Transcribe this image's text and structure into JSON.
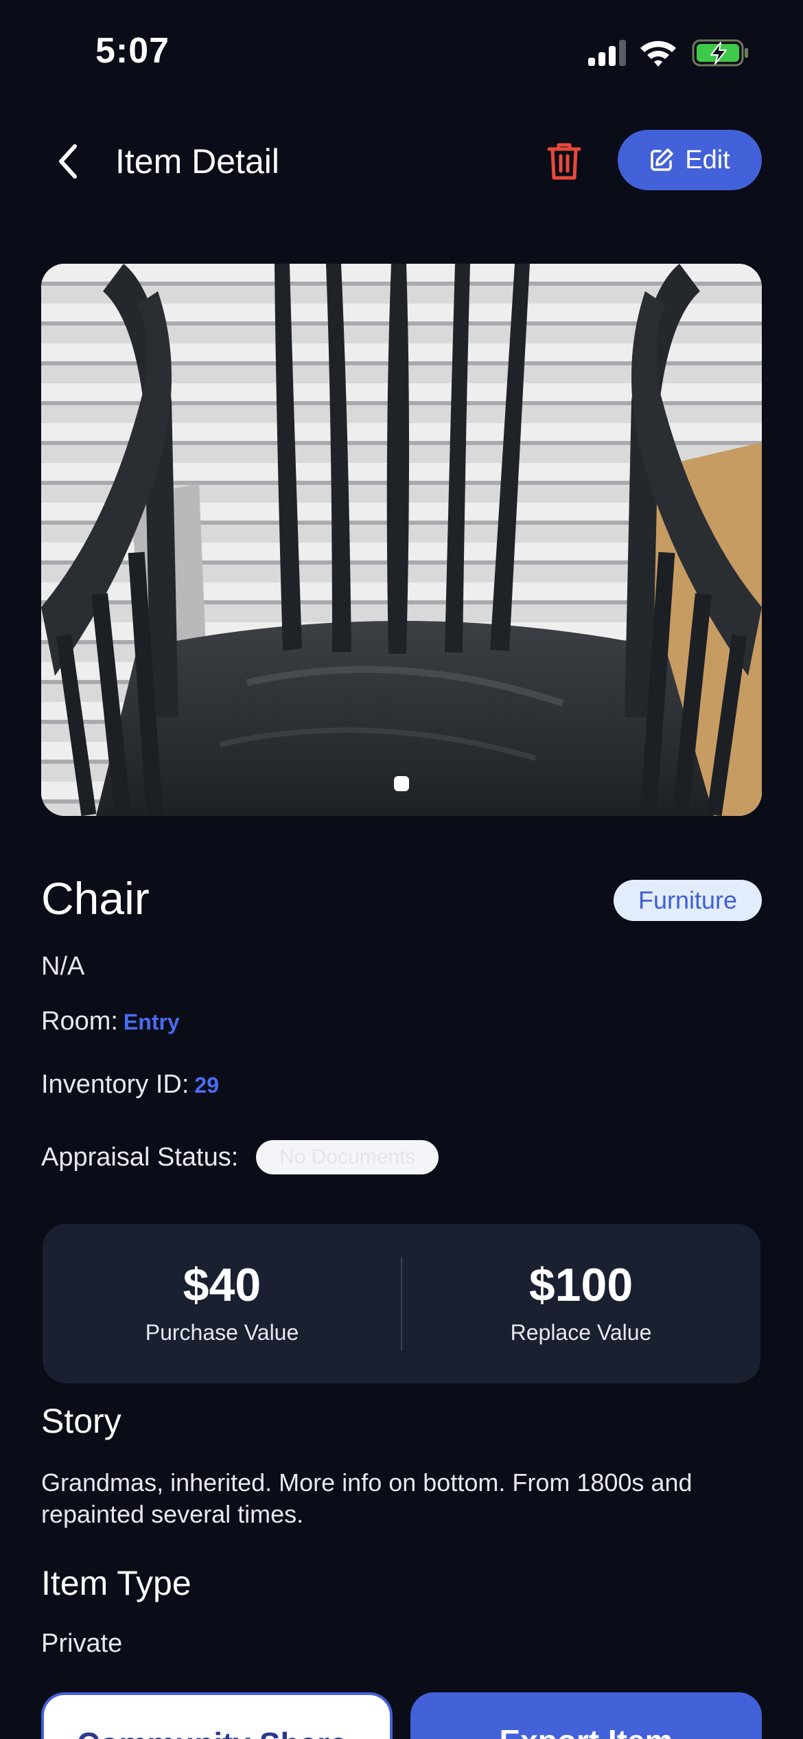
{
  "status_bar": {
    "time": "5:07"
  },
  "nav": {
    "title": "Item Detail",
    "edit_label": "Edit"
  },
  "item": {
    "name": "Chair",
    "category": "Furniture",
    "subtitle": "N/A",
    "room_label": "Room:",
    "room_value": "Entry",
    "inventory_label": "Inventory ID:",
    "inventory_value": "29",
    "appraisal_label": "Appraisal Status:",
    "appraisal_value": "No Documents"
  },
  "values": {
    "purchase_amount": "$40",
    "purchase_label": "Purchase Value",
    "replace_amount": "$100",
    "replace_label": "Replace Value"
  },
  "story": {
    "heading": "Story",
    "text": "Grandmas, inherited. More info on bottom. From 1800s and repainted several times."
  },
  "item_type": {
    "heading": "Item Type",
    "value": "Private"
  },
  "actions": {
    "share_label": "Community Share",
    "export_label": "Export Item"
  },
  "photo": {
    "pages": 1,
    "current_page": 1
  },
  "colors": {
    "background": "#0a0d18",
    "accent": "#4361d8",
    "link": "#4a6cf0",
    "delete": "#e8493a",
    "card": "#1a2030",
    "badge_bg": "#e3ecfb"
  }
}
